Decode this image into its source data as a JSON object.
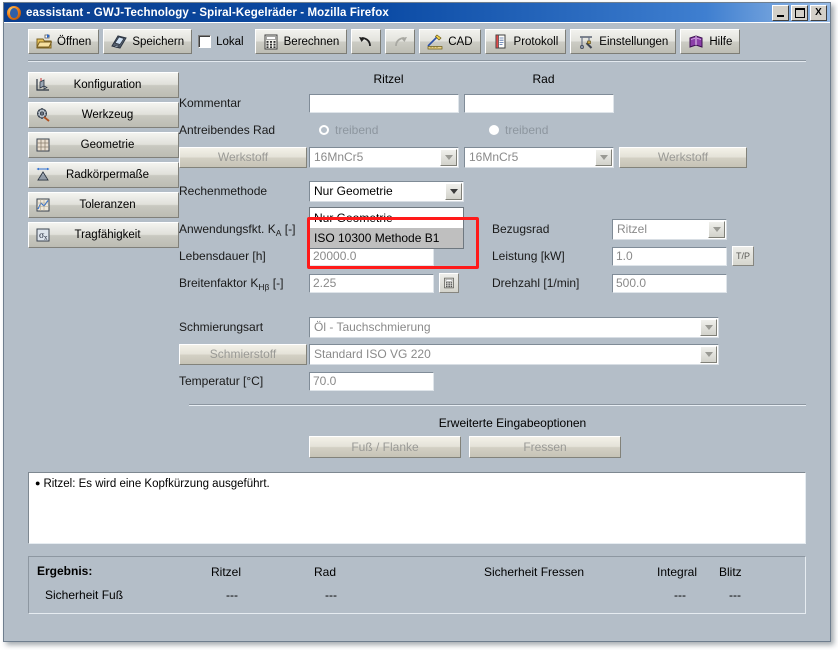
{
  "window": {
    "title": "eassistant - GWJ-Technology - Spiral-Kegelräder - Mozilla Firefox",
    "minimize": "_",
    "maximize": "□",
    "close": "X"
  },
  "toolbar": {
    "items": [
      {
        "label": "Öffnen",
        "icon": "open-folder-icon",
        "type": "button"
      },
      {
        "label": "Speichern",
        "icon": "floppy-disk-icon",
        "type": "button"
      },
      {
        "label": "Lokal",
        "icon": "checkbox-icon",
        "type": "checkbox",
        "checked": false
      },
      {
        "label": "Berechnen",
        "icon": "calculator-icon",
        "type": "button"
      },
      {
        "label": "",
        "icon": "undo-icon",
        "type": "button"
      },
      {
        "label": "",
        "icon": "redo-icon",
        "type": "button",
        "disabled": true
      },
      {
        "label": "CAD",
        "icon": "cad-pencil-icon",
        "type": "button"
      },
      {
        "label": "Protokoll",
        "icon": "report-icon",
        "type": "button"
      },
      {
        "label": "Einstellungen",
        "icon": "settings-tools-icon",
        "type": "button"
      },
      {
        "label": "Hilfe",
        "icon": "help-book-icon",
        "type": "button"
      }
    ]
  },
  "sidebar": {
    "items": [
      {
        "label": "Konfiguration",
        "icon": "configuration-icon"
      },
      {
        "label": "Werkzeug",
        "icon": "tool-gear-icon"
      },
      {
        "label": "Geometrie",
        "icon": "geometry-grid-icon"
      },
      {
        "label": "Radkörpermaße",
        "icon": "wheel-body-dimensions-icon"
      },
      {
        "label": "Toleranzen",
        "icon": "tolerances-icon"
      },
      {
        "label": "Tragfähigkeit",
        "icon": "load-capacity-icon"
      }
    ]
  },
  "form": {
    "columns": {
      "pinion": "Ritzel",
      "wheel": "Rad"
    },
    "kommentar": {
      "label": "Kommentar",
      "pinion_value": "",
      "wheel_value": ""
    },
    "antreibendes_rad": {
      "label": "Antreibendes Rad",
      "pinion_option": "treibend",
      "wheel_option": "treibend",
      "pinion_selected": false,
      "wheel_selected": true
    },
    "werkstoff": {
      "left_button": "Werkstoff",
      "right_button": "Werkstoff",
      "pinion_value": "16MnCr5",
      "wheel_value": "16MnCr5"
    },
    "rechenmethode": {
      "label": "Rechenmethode",
      "value": "Nur Geometrie",
      "open": true,
      "options": [
        "Nur Geometrie",
        "ISO 10300 Methode B1"
      ],
      "highlighted_option": "ISO 10300 Methode B1"
    },
    "anwendungsfkt": {
      "label_main": "Anwendungsfkt. K",
      "label_sub": "A",
      "label_unit": " [-]",
      "value": ""
    },
    "bezugsrad": {
      "label": "Bezugsrad",
      "value": "Ritzel"
    },
    "lebensdauer": {
      "label": "Lebensdauer [h]",
      "value": "20000.0"
    },
    "leistung": {
      "label": "Leistung [kW]",
      "value": "1.0",
      "aux_button": "T/P"
    },
    "breitenfaktor": {
      "label_main": "Breitenfaktor K",
      "label_sub": "Hβ",
      "label_unit": " [-]",
      "value": "2.25",
      "calc_icon": "calculator-icon"
    },
    "drehzahl": {
      "label": "Drehzahl [1/min]",
      "value": "500.0"
    },
    "schmierungsart": {
      "label": "Schmierungsart",
      "value": "Öl - Tauchschmierung"
    },
    "schmierstoff": {
      "label": "Schmierstoff",
      "value": "Standard ISO VG 220"
    },
    "temperatur": {
      "label": "Temperatur [°C]",
      "value": "70.0"
    },
    "erweiterte": {
      "title": "Erweiterte Eingabeoptionen",
      "buttons": [
        "Fuß / Flanke",
        "Fressen"
      ]
    }
  },
  "messages": {
    "bullet": "●",
    "items": [
      "Ritzel: Es wird eine Kopfkürzung ausgeführt."
    ]
  },
  "result": {
    "title": "Ergebnis:",
    "headers": [
      "Ritzel",
      "Rad",
      "Sicherheit Fressen",
      "Integral",
      "Blitz"
    ],
    "row_label": "Sicherheit Fuß",
    "values": [
      "---",
      "---",
      "---",
      "---"
    ]
  },
  "colors": {
    "window_bg": "#b4bec8",
    "titlebar": "#0a4aa4",
    "annotation_red": "#ff1a1a",
    "field_bg": "#ffffff",
    "selected_option_bg": "#bfbfbf"
  }
}
